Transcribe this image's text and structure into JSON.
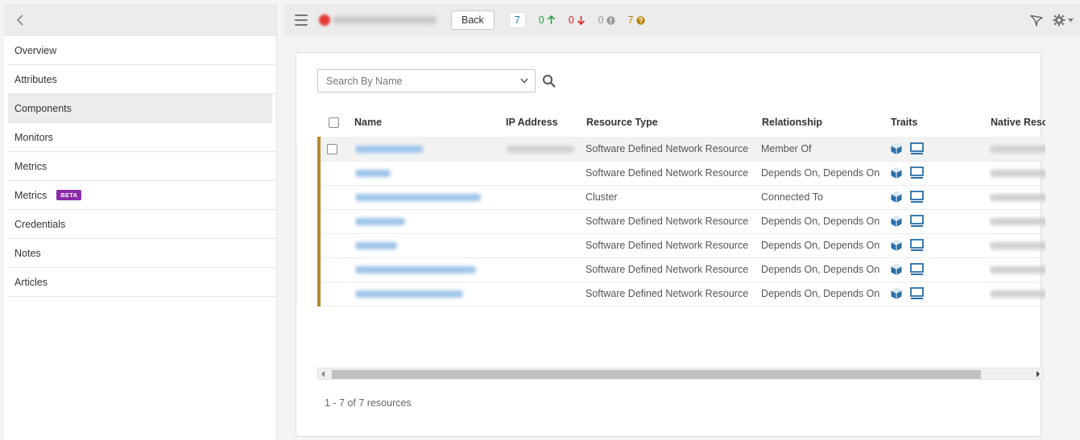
{
  "sidebar": {
    "items": [
      {
        "label": "Overview"
      },
      {
        "label": "Attributes"
      },
      {
        "label": "Components"
      },
      {
        "label": "Monitors"
      },
      {
        "label": "Metrics"
      },
      {
        "label": "Metrics",
        "badge": "BETA"
      },
      {
        "label": "Credentials"
      },
      {
        "label": "Notes"
      },
      {
        "label": "Articles"
      }
    ],
    "active_index": 2
  },
  "header": {
    "back_label": "Back",
    "counts": {
      "total": "7",
      "up": "0",
      "down": "0",
      "unknown": "0",
      "warning": "7"
    },
    "colors": {
      "up": "#2e9e47",
      "down": "#e02424",
      "unknown": "#999999",
      "warning": "#b8860b",
      "total": "#2a7ab0"
    }
  },
  "search": {
    "placeholder": "Search By Name"
  },
  "table": {
    "columns": [
      "Name",
      "IP Address",
      "Resource Type",
      "Relationship",
      "Traits",
      "Native Reso"
    ],
    "rows": [
      {
        "resource_type": "Software Defined Network Resource",
        "relationship": "Member Of"
      },
      {
        "resource_type": "Software Defined Network Resource",
        "relationship": "Depends On, Depends On"
      },
      {
        "resource_type": "Cluster",
        "relationship": "Connected To"
      },
      {
        "resource_type": "Software Defined Network Resource",
        "relationship": "Depends On, Depends On"
      },
      {
        "resource_type": "Software Defined Network Resource",
        "relationship": "Depends On, Depends On"
      },
      {
        "resource_type": "Software Defined Network Resource",
        "relationship": "Depends On, Depends On"
      },
      {
        "resource_type": "Software Defined Network Resource",
        "relationship": "Depends On, Depends On"
      }
    ],
    "trait_icons": [
      "cube-icon",
      "monitor-icon"
    ],
    "accent_color": "#b58a2a",
    "link_color": "#2a7ab0"
  },
  "pager": {
    "summary": "1 - 7 of 7 resources"
  }
}
